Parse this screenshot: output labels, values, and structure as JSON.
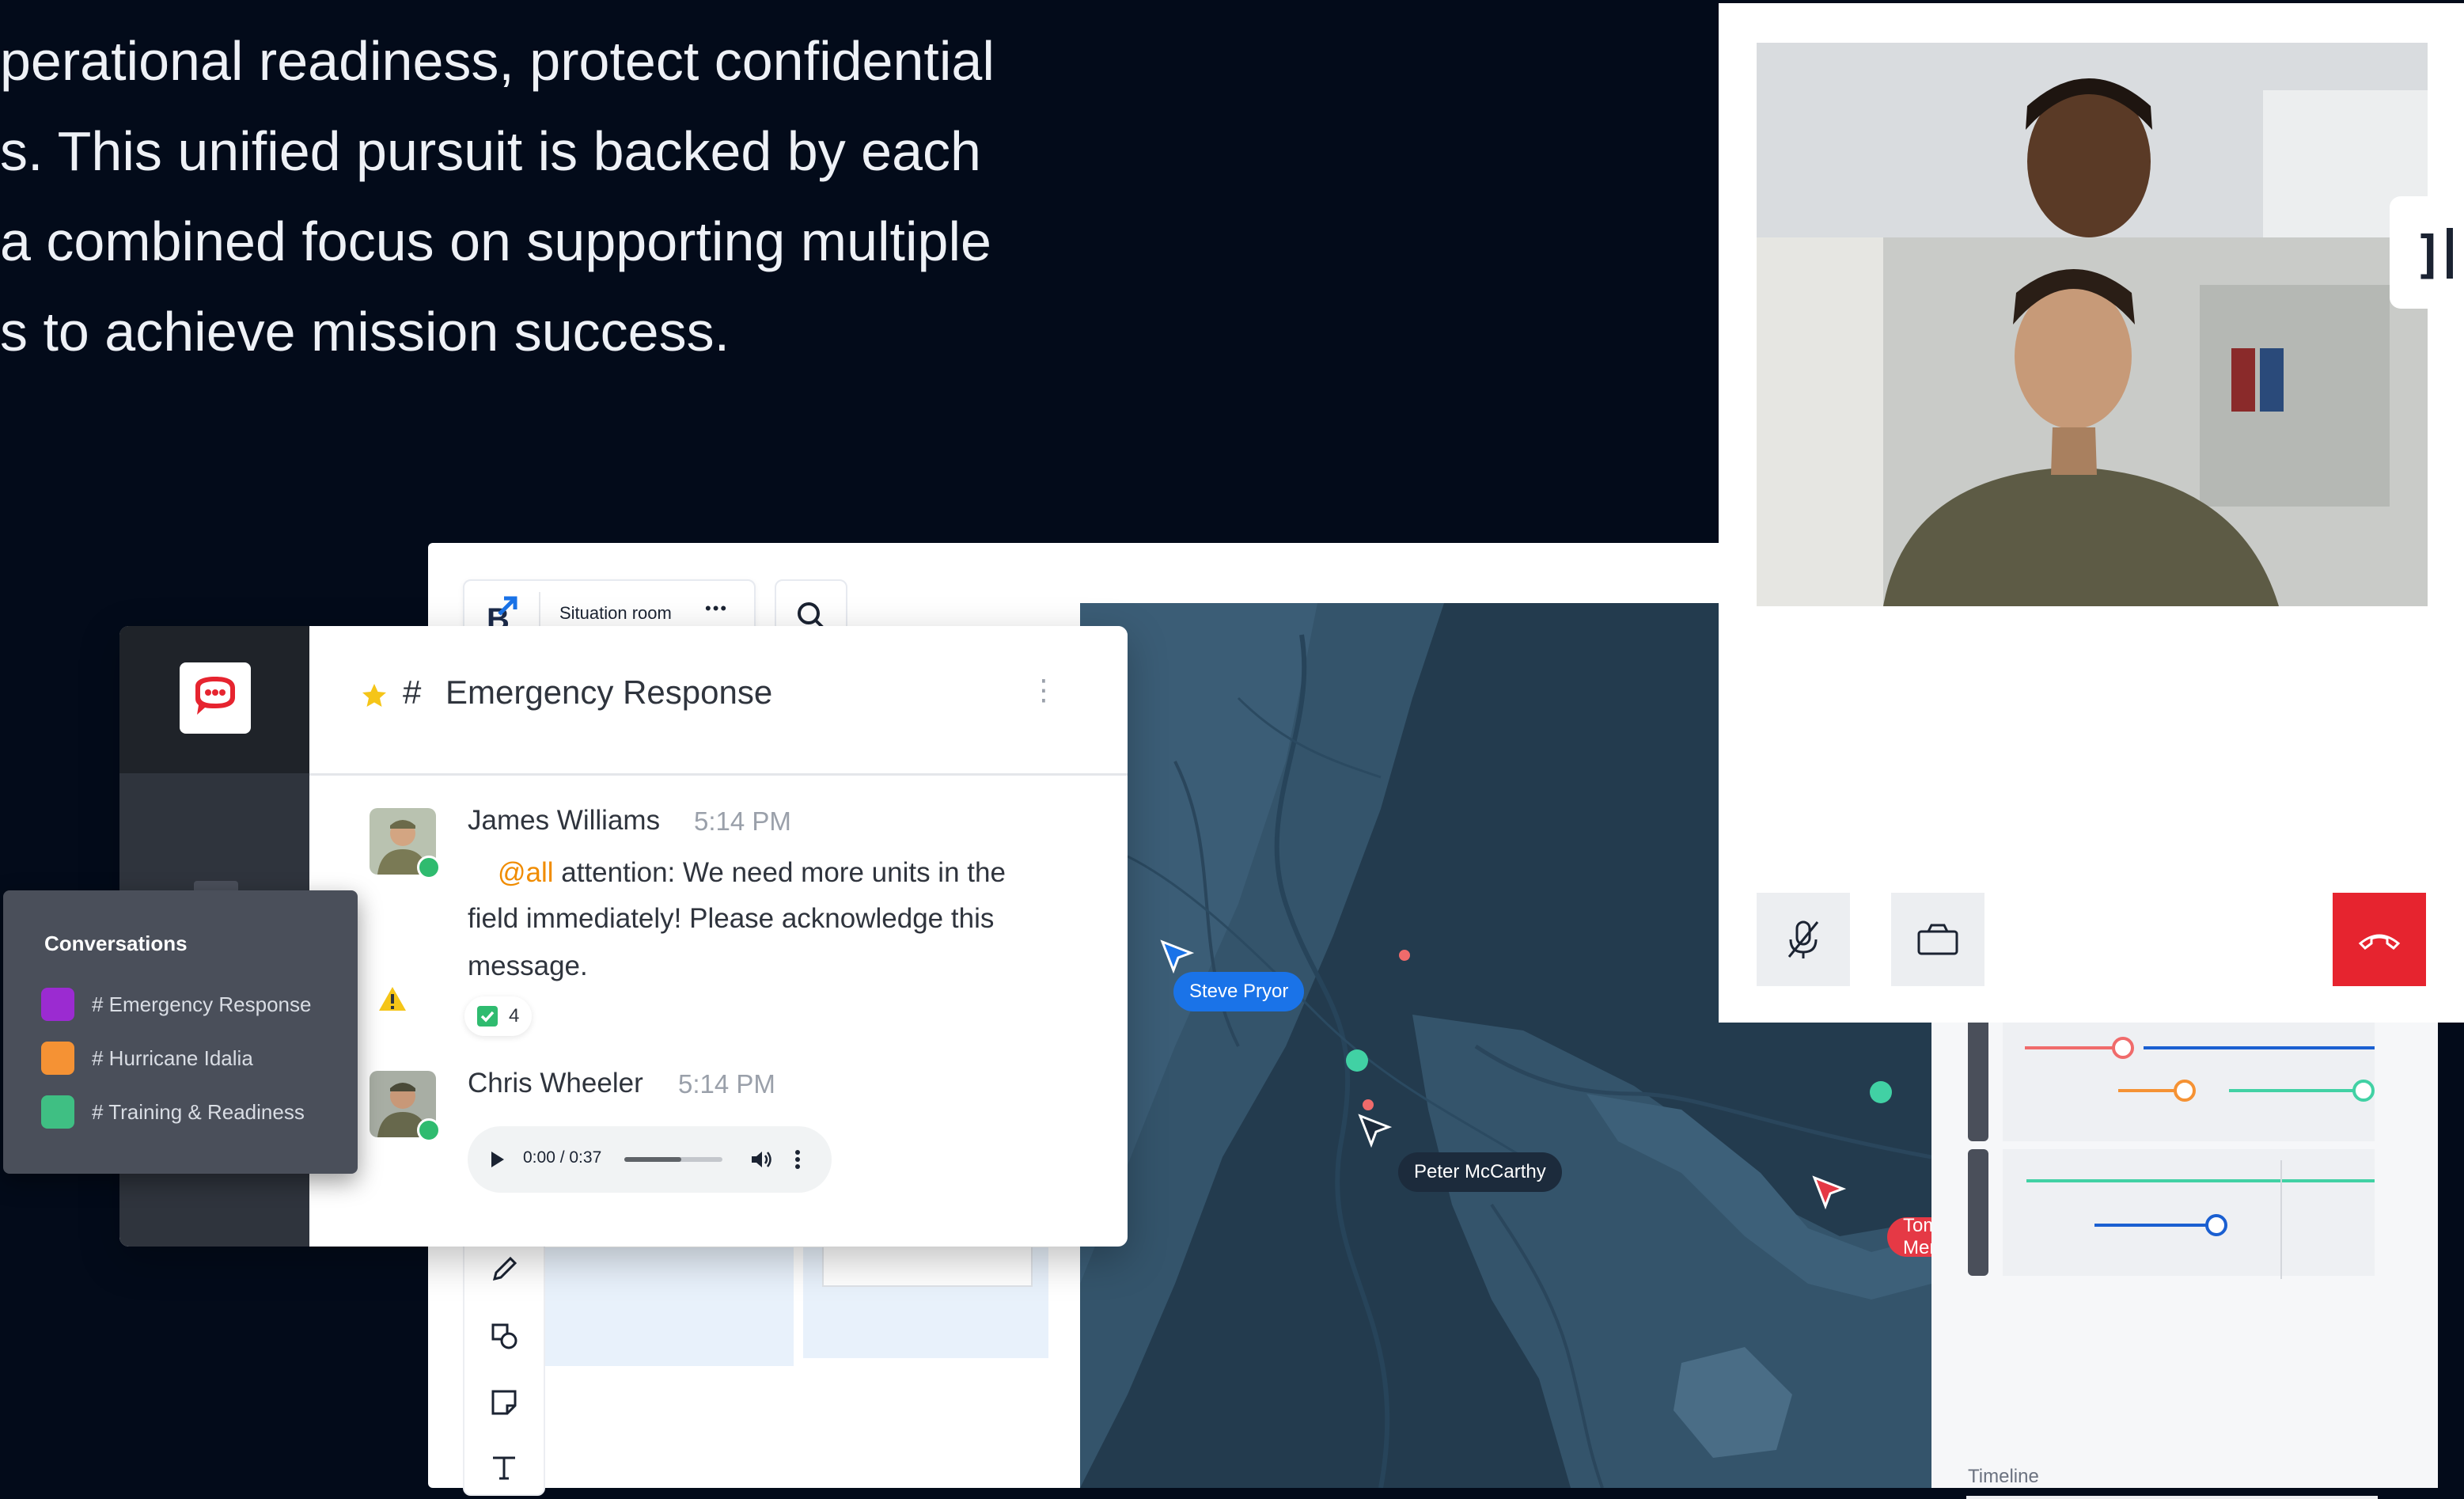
{
  "hero": {
    "lines": [
      "perational readiness, protect confidential",
      "s. This unified pursuit is backed by each",
      " a combined focus on supporting multiple",
      "s to achieve mission success."
    ]
  },
  "board": {
    "app_title": "Situation room",
    "more_label": "•••",
    "timeline_label": "Timeline",
    "map_users": [
      {
        "name": "Steve Pryor",
        "color": "#1a73e8"
      },
      {
        "name": "Peter McCarthy",
        "color": "#1c2b3c"
      },
      {
        "name": "Tom Mersman",
        "color": "#e53945"
      }
    ]
  },
  "chat": {
    "channel": "Emergency Response",
    "hash": "#",
    "menu": "⋮",
    "messages": [
      {
        "author": "James Williams",
        "time": "5:14 PM",
        "mention": "@all",
        "text_line1": " attention: We need more units in the",
        "text_line2": "field immediately! Please acknowledge this",
        "text_line3": "message.",
        "reaction_count": "4"
      },
      {
        "author": "Chris Wheeler",
        "time": "5:14 PM",
        "audio_time": "0:00 / 0:37",
        "audio_progress": 0.58
      }
    ]
  },
  "conversations": {
    "title": "Conversations",
    "items": [
      {
        "label": "# Emergency Response",
        "color": "#9b2bd1"
      },
      {
        "label": "# Hurricane Idalia",
        "color": "#f59234"
      },
      {
        "label": "# Training & Readiness",
        "color": "#3fbf83"
      }
    ]
  },
  "colors": {
    "accent_red": "#e6242f",
    "mention": "#f08c00",
    "online": "#2fbb6f"
  }
}
